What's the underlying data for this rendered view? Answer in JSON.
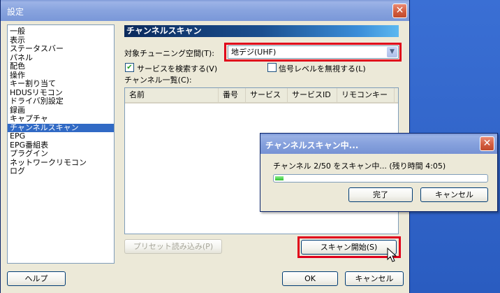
{
  "window": {
    "title": "設定"
  },
  "sidebar": {
    "items": [
      {
        "label": "一般"
      },
      {
        "label": "表示"
      },
      {
        "label": "ステータスバー"
      },
      {
        "label": "パネル"
      },
      {
        "label": "配色"
      },
      {
        "label": "操作"
      },
      {
        "label": "キー割り当て"
      },
      {
        "label": "HDUSリモコン"
      },
      {
        "label": "ドライバ別設定"
      },
      {
        "label": "録画"
      },
      {
        "label": "キャプチャ"
      },
      {
        "label": "チャンネルスキャン",
        "selected": true
      },
      {
        "label": "EPG"
      },
      {
        "label": "EPG番組表"
      },
      {
        "label": "プラグイン"
      },
      {
        "label": "ネットワークリモコン"
      },
      {
        "label": "ログ"
      }
    ]
  },
  "panel": {
    "title": "チャンネルスキャン",
    "tuning_label": "対象チューニング空間(T):",
    "tuning_value": "地デジ(UHF)",
    "search_services_label": "サービスを検索する(V)",
    "search_services_checked": true,
    "ignore_signal_label": "信号レベルを無視する(L)",
    "ignore_signal_checked": false,
    "channel_list_label": "チャンネル一覧(C):",
    "columns": [
      "名前",
      "番号",
      "サービス",
      "サービスID",
      "リモコンキー"
    ],
    "preset_button": "プリセット読み込み(P)",
    "scan_start_button": "スキャン開始(S)"
  },
  "footer": {
    "help_button": "ヘルプ",
    "ok_button": "OK",
    "cancel_button": "キャンセル"
  },
  "dialog": {
    "title": "チャンネルスキャン中...",
    "status": "チャンネル 2/50 をスキャン中... (残り時間 4:05)",
    "progress": 0.04,
    "done_button": "完了",
    "cancel_button": "キャンセル"
  },
  "colors": {
    "highlight": "#e0001a",
    "selection": "#316ac5"
  }
}
